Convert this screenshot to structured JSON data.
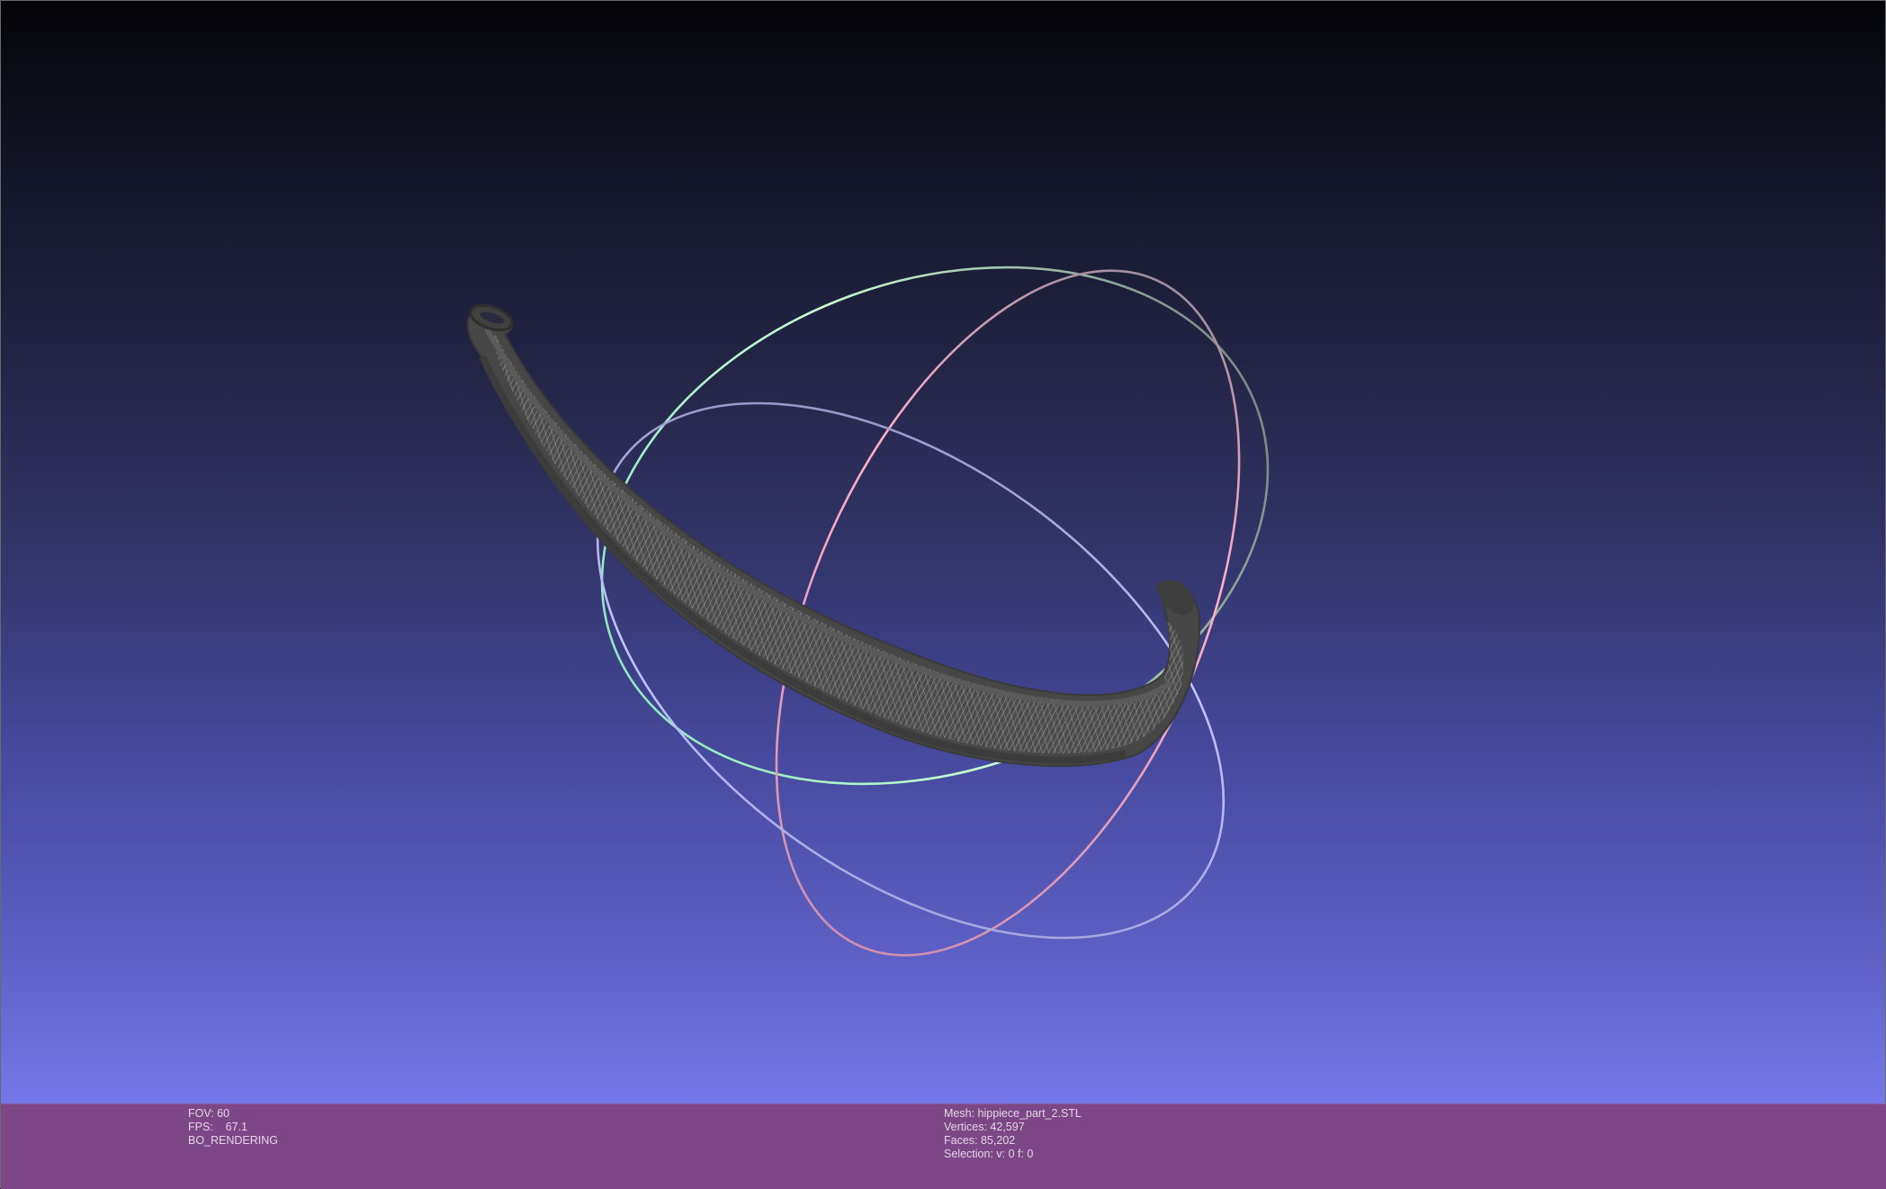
{
  "viewport": {
    "background_top": "#050509",
    "background_bottom": "#7a7cf0",
    "mesh_color": "#4a4a4a",
    "mesh_wire_color": "#9a9a9a",
    "trackball_colors": {
      "x_ring": "#ff9ab4",
      "y_ring": "#9affb4",
      "z_ring": "#a8acff",
      "neutral": "#8c8c8c"
    }
  },
  "info_bar": {
    "background": "#7d4787",
    "left": {
      "fov": "FOV: 60",
      "fps": "FPS:    67.1",
      "render_mode": "BO_RENDERING"
    },
    "right": {
      "mesh": "Mesh: hippiece_part_2.STL",
      "vertices": "Vertices: 42,597",
      "faces": "Faces: 85,202",
      "selection": "Selection: v: 0 f: 0"
    }
  }
}
